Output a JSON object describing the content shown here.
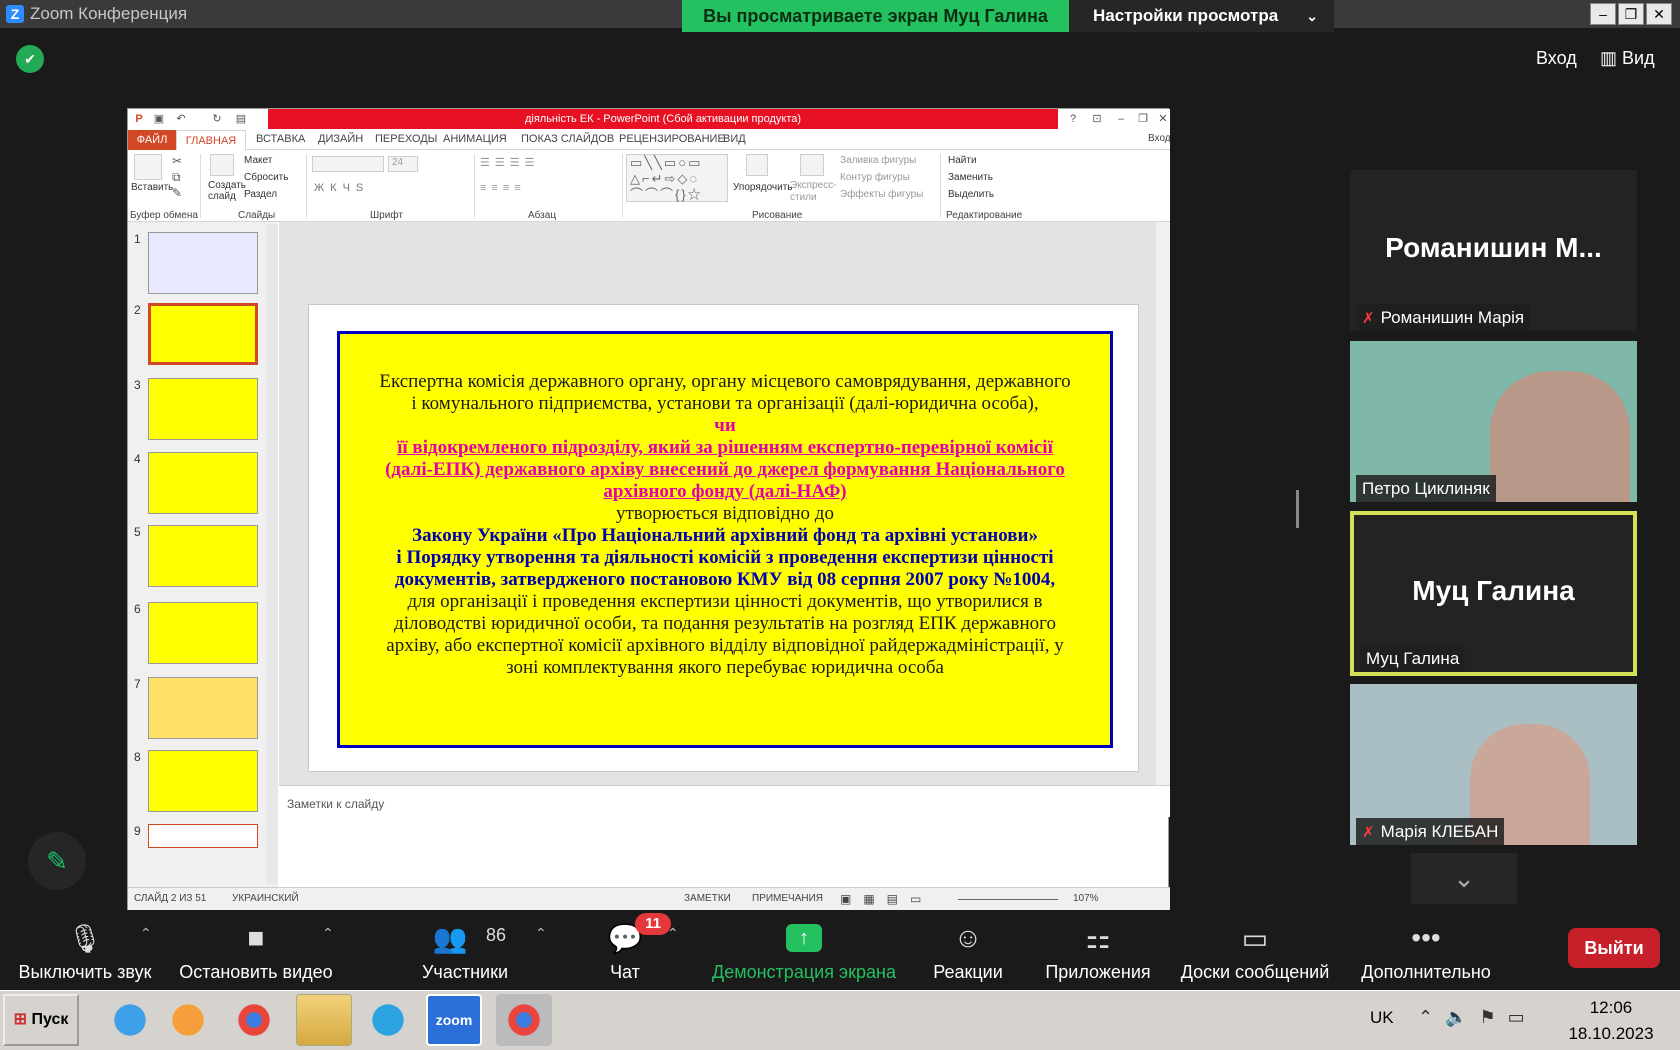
{
  "window": {
    "title": "Zoom Конференция",
    "viewing_banner": "Вы просматриваете экран Муц Галина",
    "view_options": "Настройки просмотра",
    "signin": "Вход",
    "view": "Вид"
  },
  "ppt": {
    "title": "діяльність ЕК - PowerPoint (Сбой активации продукта)",
    "login": "Вход",
    "tabs": [
      "ФАЙЛ",
      "ГЛАВНАЯ",
      "ВСТАВКА",
      "ДИЗАЙН",
      "ПЕРЕХОДЫ",
      "АНИМАЦИЯ",
      "ПОКАЗ СЛАЙДОВ",
      "РЕЦЕНЗИРОВАНИЕ",
      "ВИД"
    ],
    "ribbon": {
      "paste": "Вставить",
      "new_slide": "Создать слайд",
      "layout": "Макет",
      "reset": "Сбросить",
      "section": "Раздел",
      "font_size": "24",
      "arrange": "Упорядочить",
      "quick_styles": "Экспресс-стили",
      "shape_fill": "Заливка фигуры",
      "shape_outline": "Контур фигуры",
      "shape_effects": "Эффекты фигуры",
      "find": "Найти",
      "replace": "Заменить",
      "select": "Выделить",
      "groups": {
        "clipboard": "Буфер обмена",
        "slides": "Слайды",
        "font": "Шрифт",
        "paragraph": "Абзац",
        "drawing": "Рисование",
        "editing": "Редактирование"
      }
    },
    "thumb_numbers": [
      "1",
      "2",
      "3",
      "4",
      "5",
      "6",
      "7",
      "8",
      "9"
    ],
    "slide_lines": [
      "Експертна комісія державного органу, органу місцевого самоврядування, державного",
      "і комунального підприємства, установи та організації (далі-юридична особа),",
      "чи",
      "її відокремленого підрозділу, який за рішенням  експертно-перевірної комісії",
      "(далі-ЕПК)   державного архіву внесений до джерел формування Національного",
      "архівного фонду (далі-НАФ)",
      "утворюється відповідно до",
      "Закону України «Про Національний архівний фонд та архівні установи»",
      "і Порядку утворення та діяльності комісій з проведення експертизи цінності",
      "документів, затвердженого постановою КМУ  від 08 серпня 2007 року №1004,",
      "для організації і проведення експертизи цінності документів, що утворилися в",
      "діловодстві юридичної особи, та подання результатів на розгляд ЕПК державного",
      "архіву, або експертної комісії архівного відділу відповідної райдержадміністрації, у",
      "зоні комплектування якого перебуває юридична особа"
    ],
    "notes_placeholder": "Заметки к слайду",
    "status": {
      "slide": "СЛАЙД 2 ИЗ 51",
      "language": "УКРАИНСКИЙ",
      "notes": "ЗАМЕТКИ",
      "comments": "ПРИМЕЧАНИЯ",
      "zoom": "107%"
    }
  },
  "participants": [
    {
      "big": "Романишин  М...",
      "name": "Романишин Марія",
      "muted": true
    },
    {
      "big": "",
      "name": "Петро Циклиняк",
      "muted": false
    },
    {
      "big": "Муц Галина",
      "name": "Муц Галина",
      "muted": false
    },
    {
      "big": "",
      "name": "Марія КЛЕБАН",
      "muted": true
    }
  ],
  "toolbar": {
    "mute": "Выключить звук",
    "video": "Остановить видео",
    "participants": "Участники",
    "participants_count": "86",
    "chat": "Чат",
    "chat_badge": "11",
    "share": "Демонстрация экрана",
    "reactions": "Реакции",
    "apps": "Приложения",
    "whiteboards": "Доски сообщений",
    "more": "Дополнительно",
    "leave": "Выйти"
  },
  "taskbar": {
    "start": "Пуск",
    "lang": "UK",
    "time": "12:06",
    "date": "18.10.2023",
    "zoom_app": "zoom"
  },
  "colors": {
    "zoom_green": "#23c160",
    "slide_yellow": "#ffff00",
    "slide_border": "#0000c0",
    "magenta": "#e600aa",
    "leave_red": "#c8202b"
  }
}
